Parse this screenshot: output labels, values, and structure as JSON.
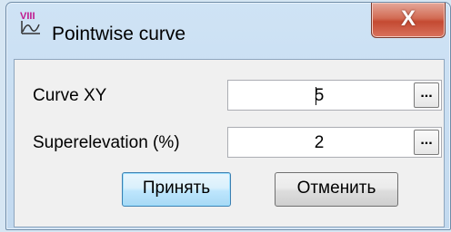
{
  "window": {
    "title": "Pointwise curve",
    "close_glyph": "X"
  },
  "icons": {
    "app": "curve-app-icon",
    "close": "close-icon"
  },
  "form": {
    "fields": [
      {
        "label": "Curve XY",
        "value": "5",
        "browse_label": "..."
      },
      {
        "label": "Superelevation (%)",
        "value": "2",
        "browse_label": "..."
      }
    ]
  },
  "buttons": {
    "accept_label": "Принять",
    "cancel_label": "Отменить"
  },
  "colors": {
    "window_frame": "#c2d9ef",
    "close_button": "#c44a32",
    "default_button_border": "#3c7fb1"
  }
}
